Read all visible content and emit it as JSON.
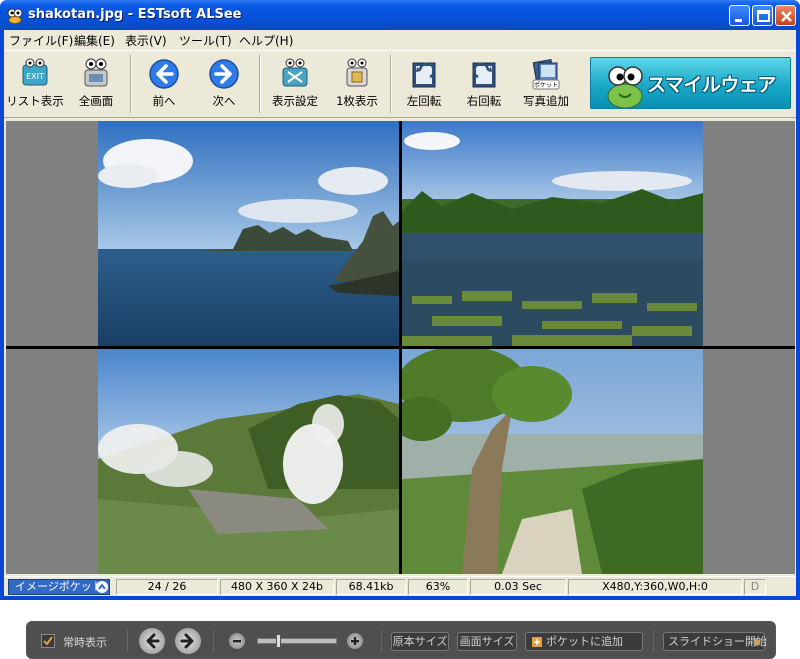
{
  "window": {
    "title": "shakotan.jpg - ESTsoft ALSee",
    "icon": "alsee-app-icon",
    "controls": [
      "minimize-icon",
      "maximize-icon",
      "close-icon"
    ]
  },
  "menu": {
    "items": [
      "ファイル(F)",
      "編集(E)",
      "表示(V)",
      "ツール(T)",
      "ヘルプ(H)"
    ]
  },
  "toolbar": {
    "buttons": [
      {
        "label": "リスト表示",
        "icon": "list-view-icon"
      },
      {
        "label": "全画面",
        "icon": "fullscreen-icon"
      },
      {
        "label": "前へ",
        "icon": "arrow-left-icon"
      },
      {
        "label": "次へ",
        "icon": "arrow-right-icon"
      },
      {
        "label": "表示設定",
        "icon": "view-settings-icon"
      },
      {
        "label": "1枚表示",
        "icon": "single-view-icon"
      },
      {
        "label": "左回転",
        "icon": "rotate-left-icon"
      },
      {
        "label": "右回転",
        "icon": "rotate-right-icon"
      },
      {
        "label": "写真追加",
        "icon": "add-photo-icon"
      }
    ],
    "pocket_icon_label": "ポケット",
    "banner_text": "スマイルウェア"
  },
  "viewer": {
    "images": [
      "coast-rocks-photo",
      "lake-forest-photo",
      "volcanic-steam-photo",
      "tree-overlook-photo"
    ]
  },
  "overlay": {
    "always_show_label": "常時表示",
    "always_show_checked": true,
    "original_size_label": "原本サイズ",
    "screen_size_label": "画面サイズ",
    "add_to_pocket_label": "ポケットに追加",
    "slideshow_label": "スライドショー開始",
    "zoom_level": 0.25
  },
  "status": {
    "pocket_label": "イメージポケット",
    "position": "24 / 26",
    "dimensions": "480 X 360 X 24b",
    "filesize": "68.41kb",
    "zoom": "63%",
    "time": "0.03 Sec",
    "coords": "X480,Y:360,W0,H:0",
    "indicator": "D"
  },
  "colors": {
    "titlebar": "#0a59e6",
    "face": "#ece9d8",
    "banner": "#1aa8c8",
    "pocket": "#316ac5"
  }
}
